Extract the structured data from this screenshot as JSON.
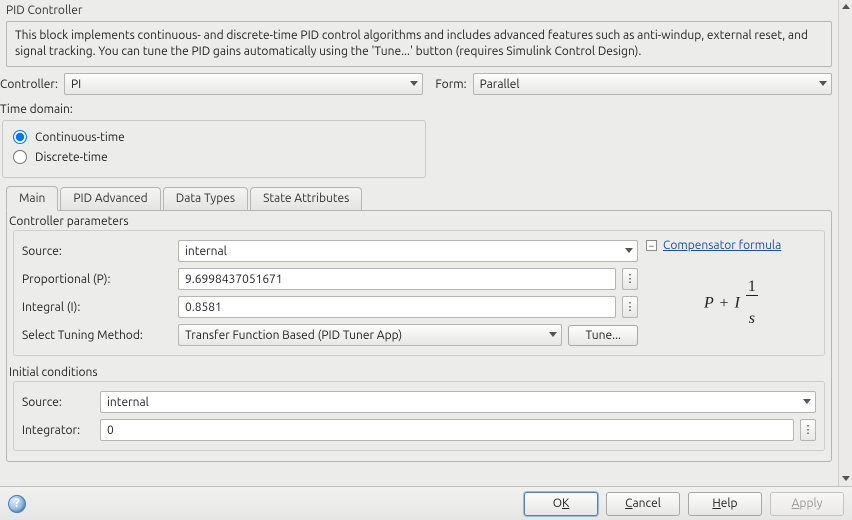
{
  "block": {
    "title": "PID Controller",
    "description": "This block implements continuous- and discrete-time PID control algorithms and includes advanced features such as anti-windup, external reset, and signal tracking. You can tune the PID gains automatically using the 'Tune...' button (requires Simulink Control Design)."
  },
  "top": {
    "controller_label": "Controller:",
    "controller_value": "PI",
    "form_label": "Form:",
    "form_value": "Parallel"
  },
  "time_domain": {
    "label": "Time domain:",
    "continuous": "Continuous-time",
    "discrete": "Discrete-time",
    "selected": "continuous"
  },
  "tabs": {
    "main": "Main",
    "pid_advanced": "PID Advanced",
    "data_types": "Data Types",
    "state_attributes": "State Attributes",
    "active": "main"
  },
  "controller_params": {
    "title": "Controller parameters",
    "source_label": "Source:",
    "source_value": "internal",
    "p_label": "Proportional (P):",
    "p_value": "9.6998437051671",
    "i_label": "Integral (I):",
    "i_value": "0.8581",
    "tuning_label": "Select Tuning Method:",
    "tuning_value": "Transfer Function Based (PID Tuner App)",
    "tune_button": "Tune...",
    "compensator_link": "Compensator formula",
    "formula_P": "P",
    "formula_plus": "+",
    "formula_I": "I",
    "formula_num": "1",
    "formula_den": "s"
  },
  "initial_conditions": {
    "title": "Initial conditions",
    "source_label": "Source:",
    "source_value": "internal",
    "integrator_label": "Integrator:",
    "integrator_value": "0"
  },
  "buttons": {
    "ok_pre": "O",
    "ok_mn": "K",
    "cancel_mn": "C",
    "cancel_post": "ancel",
    "help_mn": "H",
    "help_post": "elp",
    "apply_mn": "A",
    "apply_post": "pply"
  }
}
